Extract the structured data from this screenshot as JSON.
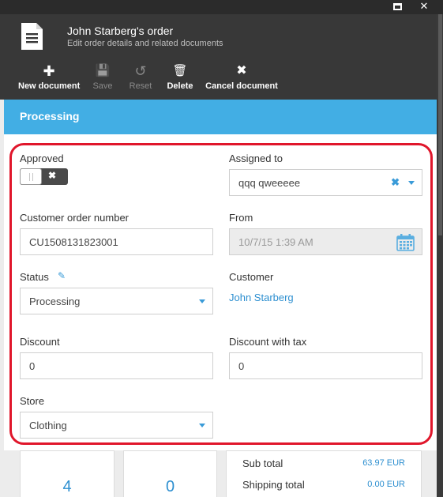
{
  "window": {
    "maximize_icon": "maximize-icon",
    "close_icon": "close-icon",
    "close_glyph": "✕"
  },
  "header": {
    "title": "John Starberg's order",
    "subtitle": "Edit order details and related documents",
    "icon": "document-icon"
  },
  "toolbar": {
    "items": [
      {
        "label": "New document",
        "glyph": "✚",
        "icon": "plus-icon",
        "enabled": true
      },
      {
        "label": "Save",
        "glyph": "💾",
        "icon": "save-icon",
        "enabled": false
      },
      {
        "label": "Reset",
        "glyph": "↺",
        "icon": "reset-icon",
        "enabled": false
      },
      {
        "label": "Delete",
        "glyph": "🗑",
        "icon": "trash-icon",
        "enabled": true
      },
      {
        "label": "Cancel document",
        "glyph": "✖",
        "icon": "cancel-icon",
        "enabled": true
      }
    ]
  },
  "status_banner": {
    "text": "Processing",
    "color": "#42aee4"
  },
  "form": {
    "approved": {
      "label": "Approved",
      "toggle_off_glyph": "✖",
      "value": false
    },
    "assigned_to": {
      "label": "Assigned to",
      "value": "qqq qweeeee",
      "clear_glyph": "✖"
    },
    "customer_order_number": {
      "label": "Customer order number",
      "value": "CU1508131823001"
    },
    "from": {
      "label": "From",
      "value": "10/7/15 1:39 AM"
    },
    "status": {
      "label": "Status",
      "value": "Processing",
      "edit_glyph": "✎"
    },
    "customer": {
      "label": "Customer",
      "value": "John Starberg"
    },
    "discount": {
      "label": "Discount",
      "value": "0"
    },
    "discount_with_tax": {
      "label": "Discount with tax",
      "value": "0"
    },
    "store": {
      "label": "Store",
      "value": "Clothing"
    }
  },
  "stats": {
    "first": "4",
    "second": "0"
  },
  "totals": {
    "sub_total_label": "Sub total",
    "sub_total_value": "63.97 EUR",
    "shipping_total_label": "Shipping total",
    "shipping_total_value": "0.00 EUR"
  },
  "colors": {
    "accent": "#42aee4",
    "link": "#2d8fd0",
    "highlight_frame": "#e0162b",
    "header_bg": "#383838"
  }
}
